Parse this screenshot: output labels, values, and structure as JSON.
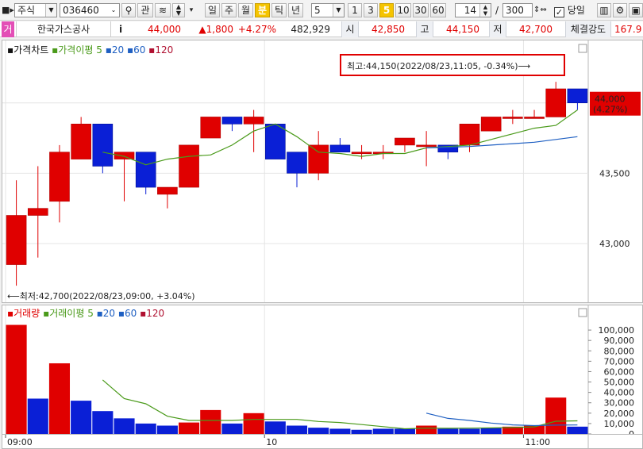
{
  "toolbar": {
    "market_type": "주식",
    "stock_code": "036460",
    "btn_gwan": "관",
    "periods": [
      "일",
      "주",
      "월",
      "분",
      "틱",
      "년"
    ],
    "active_period": "분",
    "interval_value": "5",
    "intervals": [
      "1",
      "3",
      "5",
      "10",
      "30",
      "60"
    ],
    "active_interval": "5",
    "view_count": "14",
    "total_count": "300",
    "same_day_label": "당일",
    "same_day_checked": true
  },
  "quote": {
    "badge": "거",
    "name": "한국가스공사",
    "info_icon": "i",
    "price": "44,000",
    "change": "▲1,800",
    "change_pct": "+4.27%",
    "volume": "482,929",
    "open_label": "시",
    "open": "42,850",
    "high_label": "고",
    "high": "44,150",
    "low_label": "저",
    "low": "42,700",
    "strength_label": "체결강도",
    "strength": "167.9"
  },
  "price_chart": {
    "legend": {
      "title": "가격차트",
      "ma_label": "가격이평",
      "ma_periods": [
        "5",
        "20",
        "60",
        "120"
      ],
      "ma_colors": [
        "#4a9a1a",
        "#1e5fc2",
        "#1e5fc2",
        "#b01030"
      ]
    },
    "high_annotation": "최고:44,150(2022/08/23,11:05, -0.34%)⟶",
    "low_annotation": "⟵최저:42,700(2022/08/23,09:00, +3.04%)",
    "current_price": "44,000",
    "current_pct": "(4.27%)",
    "y_ticks": [
      {
        "v": 43500,
        "label": "43,500"
      },
      {
        "v": 43000,
        "label": "43,000"
      }
    ]
  },
  "volume_chart": {
    "legend": {
      "title": "거래량",
      "ma_label": "거래이평",
      "ma_periods": [
        "5",
        "20",
        "60",
        "120"
      ],
      "ma_colors": [
        "#4a9a1a",
        "#1e5fc2",
        "#1e5fc2",
        "#b01030"
      ]
    },
    "y_ticks": [
      "100,000",
      "90,000",
      "80,000",
      "70,000",
      "60,000",
      "50,000",
      "40,000",
      "30,000",
      "20,000",
      "10,000",
      "0"
    ]
  },
  "x_axis_labels": [
    {
      "label": "09:00",
      "index": 0
    },
    {
      "label": "10",
      "index": 12
    },
    {
      "label": "11:00",
      "index": 24
    }
  ],
  "chart_data": [
    {
      "type": "candlestick",
      "ylim": [
        42650,
        44320
      ],
      "candles": [
        {
          "o": 42850,
          "h": 43450,
          "l": 42700,
          "c": 43200,
          "up": true
        },
        {
          "o": 43200,
          "h": 43550,
          "l": 42900,
          "c": 43250,
          "up": true
        },
        {
          "o": 43300,
          "h": 43700,
          "l": 43150,
          "c": 43650,
          "up": true
        },
        {
          "o": 43600,
          "h": 43900,
          "l": 43600,
          "c": 43850,
          "up": true
        },
        {
          "o": 43850,
          "h": 43850,
          "l": 43500,
          "c": 43550,
          "down": true
        },
        {
          "o": 43600,
          "h": 43650,
          "l": 43300,
          "c": 43650,
          "up": true
        },
        {
          "o": 43650,
          "h": 43650,
          "l": 43350,
          "c": 43400,
          "down": true
        },
        {
          "o": 43350,
          "h": 43400,
          "l": 43250,
          "c": 43400,
          "up": true
        },
        {
          "o": 43400,
          "h": 43700,
          "l": 43400,
          "c": 43700,
          "up": true
        },
        {
          "o": 43750,
          "h": 43900,
          "l": 43750,
          "c": 43900,
          "up": true
        },
        {
          "o": 43900,
          "h": 43900,
          "l": 43800,
          "c": 43850,
          "down": true
        },
        {
          "o": 43850,
          "h": 43950,
          "l": 43650,
          "c": 43900,
          "up": true
        },
        {
          "o": 43850,
          "h": 43850,
          "l": 43600,
          "c": 43600,
          "down": true
        },
        {
          "o": 43650,
          "h": 43650,
          "l": 43400,
          "c": 43500,
          "down": true
        },
        {
          "o": 43500,
          "h": 43800,
          "l": 43450,
          "c": 43700,
          "up": true
        },
        {
          "o": 43700,
          "h": 43750,
          "l": 43650,
          "c": 43650,
          "down": true
        },
        {
          "o": 43650,
          "h": 43700,
          "l": 43600,
          "c": 43650,
          "flat": true
        },
        {
          "o": 43650,
          "h": 43700,
          "l": 43600,
          "c": 43650,
          "flat": true
        },
        {
          "o": 43700,
          "h": 43750,
          "l": 43650,
          "c": 43750,
          "up": true
        },
        {
          "o": 43700,
          "h": 43800,
          "l": 43550,
          "c": 43700,
          "flat": true
        },
        {
          "o": 43700,
          "h": 43700,
          "l": 43600,
          "c": 43650,
          "down": true
        },
        {
          "o": 43700,
          "h": 43850,
          "l": 43650,
          "c": 43850,
          "up": true
        },
        {
          "o": 43800,
          "h": 43900,
          "l": 43800,
          "c": 43900,
          "up": true
        },
        {
          "o": 43900,
          "h": 43950,
          "l": 43850,
          "c": 43900,
          "flat": true
        },
        {
          "o": 43900,
          "h": 43950,
          "l": 43900,
          "c": 43900,
          "flat": true
        },
        {
          "o": 43900,
          "h": 44150,
          "l": 43900,
          "c": 44100,
          "up": true
        },
        {
          "o": 44100,
          "h": 44100,
          "l": 43950,
          "c": 44000,
          "down": true
        }
      ],
      "ma5": [
        null,
        null,
        null,
        null,
        43650,
        43620,
        43560,
        43600,
        43620,
        43630,
        43700,
        43800,
        43850,
        43760,
        43650,
        43640,
        43620,
        43640,
        43640,
        43680,
        43690,
        43700,
        43740,
        43780,
        43820,
        43840,
        43950
      ],
      "ma20": [
        null,
        null,
        null,
        null,
        null,
        null,
        null,
        null,
        null,
        null,
        null,
        null,
        null,
        null,
        null,
        null,
        null,
        null,
        null,
        43680,
        43685,
        43690,
        43700,
        43710,
        43720,
        43740,
        43760
      ]
    },
    {
      "type": "bar",
      "title": "거래량",
      "ylim": [
        0,
        110000
      ],
      "values": [
        105000,
        34000,
        68000,
        32000,
        22000,
        15000,
        10000,
        8000,
        11000,
        23000,
        10000,
        20000,
        12000,
        8000,
        6000,
        5000,
        4000,
        5000,
        5000,
        8000,
        5000,
        5000,
        6000,
        7000,
        8000,
        35000,
        7000
      ],
      "up": [
        true,
        false,
        true,
        false,
        false,
        false,
        false,
        false,
        true,
        true,
        false,
        true,
        false,
        false,
        false,
        false,
        false,
        false,
        false,
        true,
        false,
        false,
        false,
        true,
        true,
        true,
        false
      ],
      "ma5": [
        null,
        null,
        null,
        null,
        52000,
        34000,
        29000,
        17000,
        13000,
        13000,
        13000,
        14000,
        14000,
        14000,
        12000,
        11000,
        9000,
        7000,
        5000,
        5600,
        5400,
        5600,
        5800,
        6200,
        6800,
        12200,
        12600
      ],
      "ma20": [
        null,
        null,
        null,
        null,
        null,
        null,
        null,
        null,
        null,
        null,
        null,
        null,
        null,
        null,
        null,
        null,
        null,
        null,
        null,
        20000,
        15000,
        13000,
        10500,
        8700,
        8000,
        8500,
        8600
      ]
    }
  ]
}
